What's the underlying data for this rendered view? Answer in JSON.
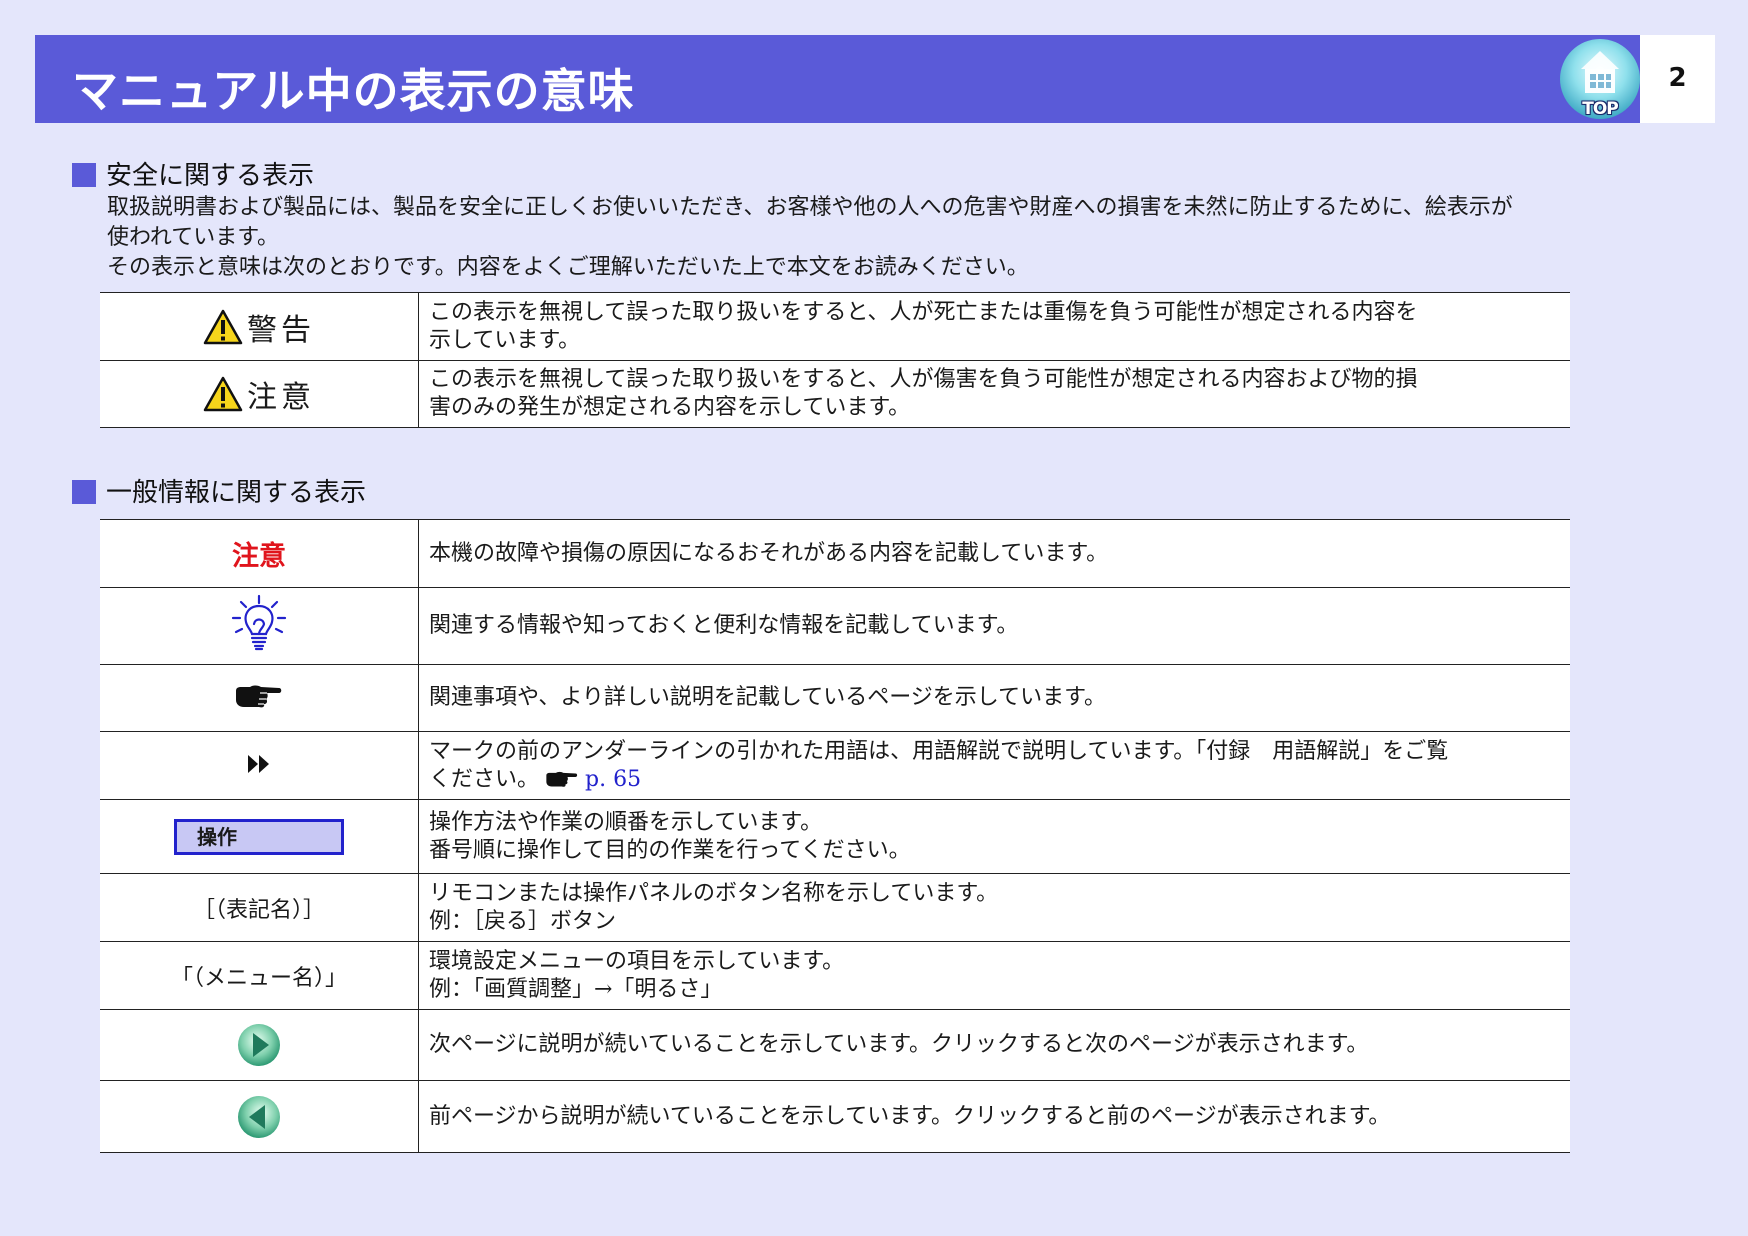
{
  "header": {
    "title": "マニュアル中の表示の意味",
    "page_number": "2",
    "top_button_label": "TOP",
    "top_button_icon": "projector-icon",
    "accent_color": "#5a5ad8"
  },
  "safety": {
    "heading": "安全に関する表示",
    "intro_lines": [
      "取扱説明書および製品には、製品を安全に正しくお使いいただき、お客様や他の人への危害や財産への損害を未然に防止するために、絵表示が",
      "使われています。",
      "その表示と意味は次のとおりです。内容をよくご理解いただいた上で本文をお読みください。"
    ],
    "rows": [
      {
        "label": "警告",
        "icon": "warning-triangle-icon",
        "desc_lines": [
          "この表示を無視して誤った取り扱いをすると、人が死亡または重傷を負う可能性が想定される内容を",
          "示しています。"
        ]
      },
      {
        "label": "注意",
        "icon": "warning-triangle-icon",
        "desc_lines": [
          "この表示を無視して誤った取り扱いをすると、人が傷害を負う可能性が想定される内容および物的損",
          "害のみの発生が想定される内容を示しています。"
        ]
      }
    ]
  },
  "general": {
    "heading": "一般情報に関する表示",
    "rows": [
      {
        "symbol_text": "注意",
        "symbol_color": "#e0141c",
        "desc_lines": [
          "本機の故障や損傷の原因になるおそれがある内容を記載しています。"
        ]
      },
      {
        "icon": "lightbulb-icon",
        "desc_lines": [
          "関連する情報や知っておくと便利な情報を記載しています。"
        ]
      },
      {
        "icon": "pointing-hand-icon",
        "desc_lines": [
          "関連事項や、より詳しい説明を記載しているページを示しています。"
        ]
      },
      {
        "icon": "double-arrow-icon",
        "desc_lines": [
          "マークの前のアンダーラインの引かれた用語は、用語解説で説明しています。「付録　用語解説」をご覧",
          "ください。"
        ],
        "link_text": "p. 65"
      },
      {
        "symbol_text": "操作",
        "desc_lines": [
          "操作方法や作業の順番を示しています。",
          "番号順に操作して目的の作業を行ってください。"
        ]
      },
      {
        "symbol_text": "［（表記名）］",
        "desc_lines": [
          "リモコンまたは操作パネルのボタン名称を示しています。",
          "例：［戻る］ボタン"
        ]
      },
      {
        "symbol_text": "「（メニュー名）」",
        "desc_lines": [
          "環境設定メニューの項目を示しています。",
          "例：「画質調整」→「明るさ」"
        ]
      },
      {
        "icon": "next-page-icon",
        "desc_lines": [
          "次ページに説明が続いていることを示しています。クリックすると次のページが表示されます。"
        ]
      },
      {
        "icon": "previous-page-icon",
        "desc_lines": [
          "前ページから説明が続いていることを示しています。クリックすると前のページが表示されます。"
        ]
      }
    ]
  }
}
